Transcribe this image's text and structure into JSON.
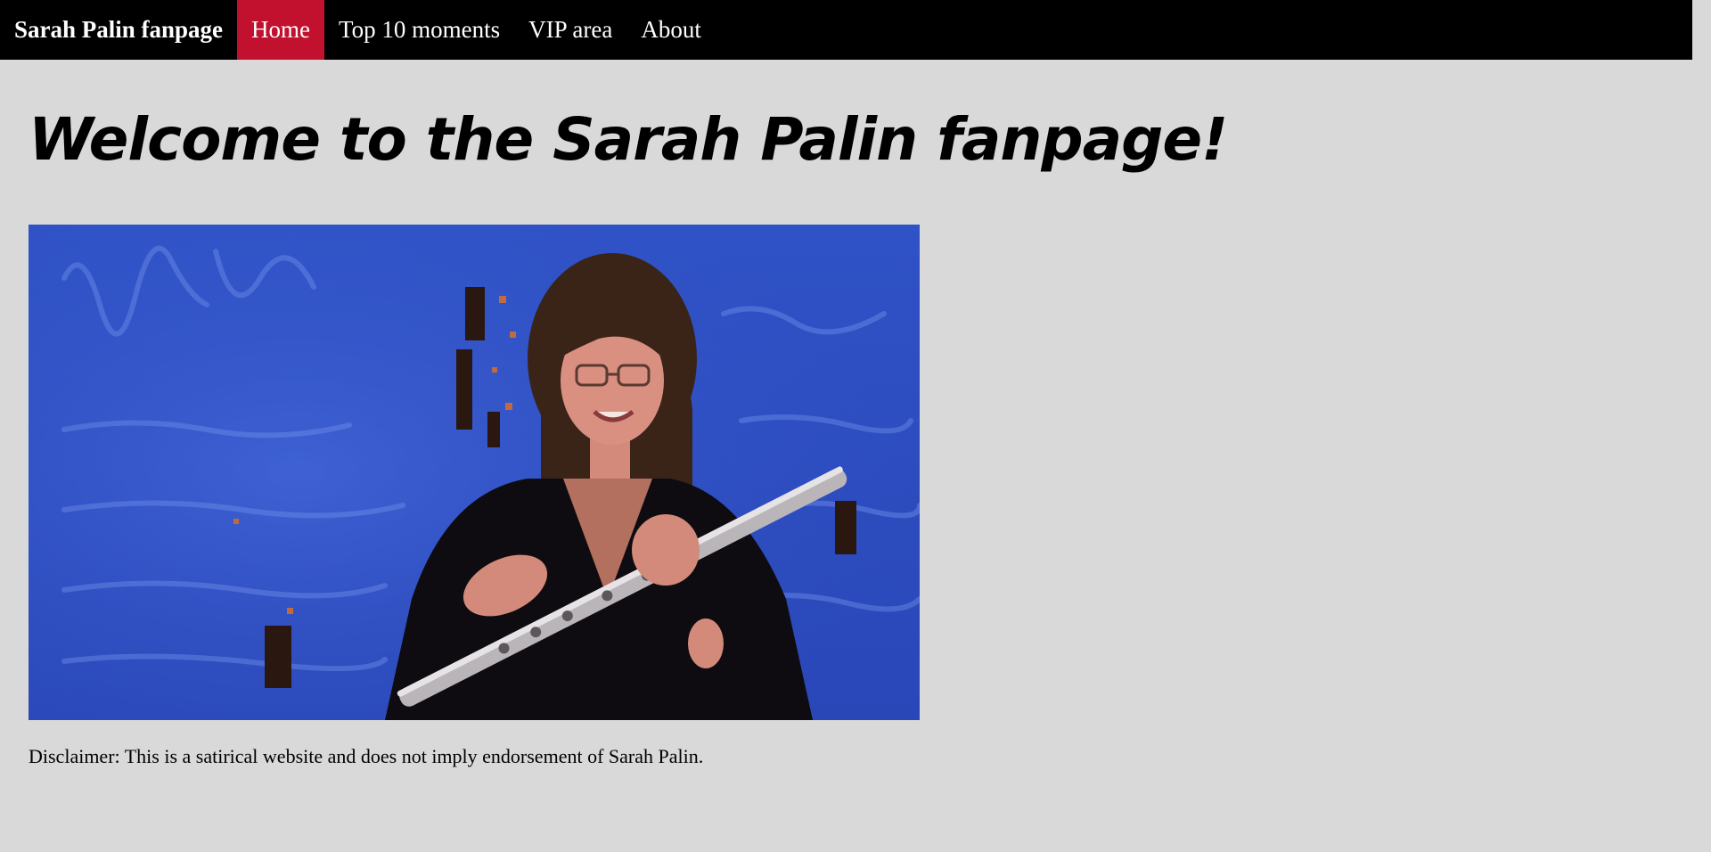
{
  "nav": {
    "brand": "Sarah Palin fanpage",
    "items": [
      {
        "label": "Home",
        "active": true
      },
      {
        "label": "Top 10 moments",
        "active": false
      },
      {
        "label": "VIP area",
        "active": false
      },
      {
        "label": "About",
        "active": false
      }
    ]
  },
  "colors": {
    "nav_background": "#000000",
    "nav_active": "#c2102f",
    "page_background": "#d9d9d9",
    "image_background": "#2f52c6"
  },
  "main": {
    "title": "Welcome to the Sarah Palin fanpage!",
    "disclaimer": "Disclaimer: This is a satirical website and does not imply endorsement of Sarah Palin."
  }
}
